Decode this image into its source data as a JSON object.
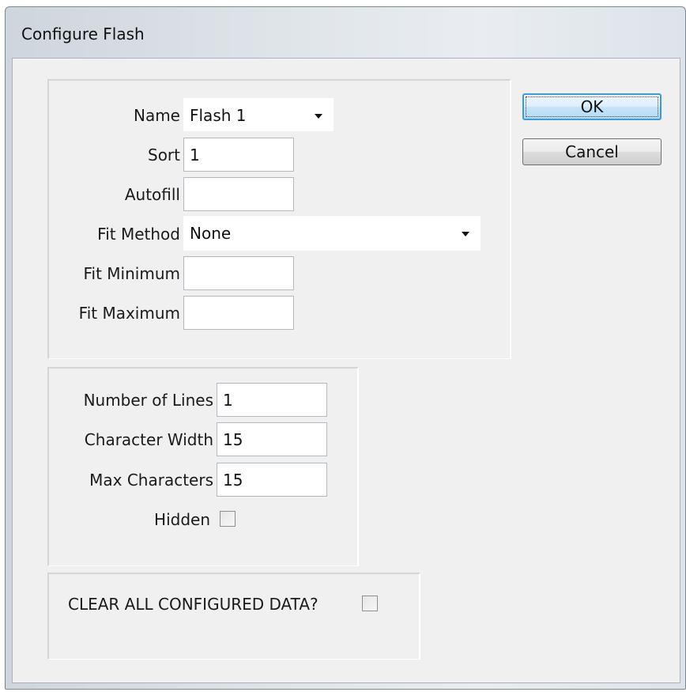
{
  "window": {
    "title": "Configure Flash"
  },
  "buttons": {
    "ok": "OK",
    "cancel": "Cancel"
  },
  "group1": {
    "name_label": "Name",
    "name_value": "Flash 1",
    "sort_label": "Sort",
    "sort_value": "1",
    "autofill_label": "Autofill",
    "autofill_value": "",
    "fit_method_label": "Fit Method",
    "fit_method_value": "None",
    "fit_min_label": "Fit Minimum",
    "fit_min_value": "",
    "fit_max_label": "Fit Maximum",
    "fit_max_value": ""
  },
  "group2": {
    "lines_label": "Number of Lines",
    "lines_value": "1",
    "char_width_label": "Character Width",
    "char_width_value": "15",
    "max_chars_label": "Max Characters",
    "max_chars_value": "15",
    "hidden_label": "Hidden",
    "hidden_checked": false
  },
  "group3": {
    "clear_label": "CLEAR ALL CONFIGURED DATA?",
    "clear_checked": false
  }
}
